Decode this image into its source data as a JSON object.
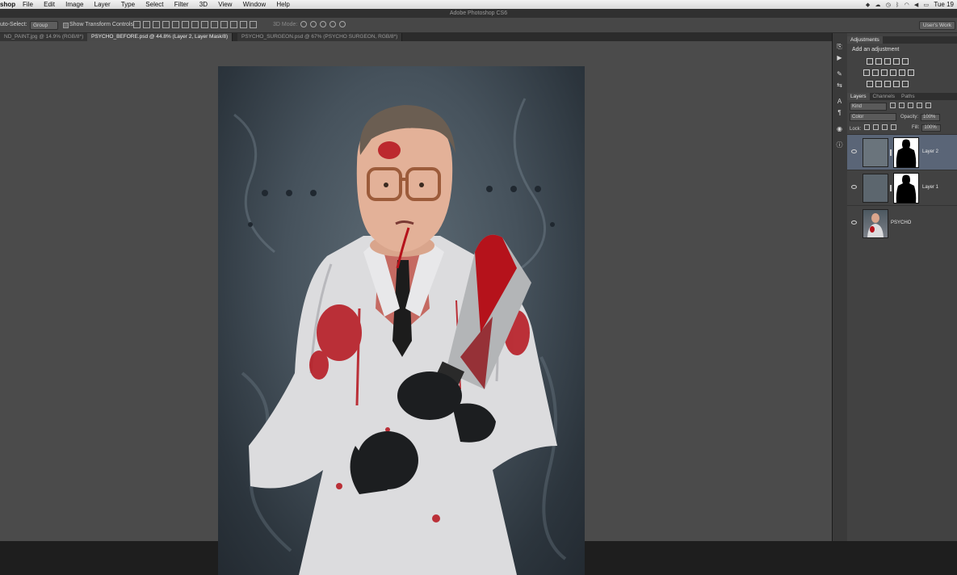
{
  "menubar": {
    "app_name": "shop",
    "menus": [
      "File",
      "Edit",
      "Image",
      "Layer",
      "Type",
      "Select",
      "Filter",
      "3D",
      "View",
      "Window",
      "Help"
    ],
    "clock": "Tue 19"
  },
  "window": {
    "title": "Adobe Photoshop CS6"
  },
  "options_bar": {
    "auto_select_label": "uto-Select:",
    "auto_select_value": "Group",
    "show_transform_label": "Show Transform Controls",
    "mode_label": "3D Mode:",
    "workspace": "User's Work"
  },
  "document_tabs": [
    {
      "label": "ND_PAINT.jpg @ 14.9% (RGB/8*)",
      "active": false
    },
    {
      "label": "PSYCHO_BEFORE.psd @ 44.8% (Layer 2, Layer Mask/8)",
      "active": true
    },
    {
      "label": "PSYCHO_SURGEON.psd @ 67% (PSYCHO SURGEON, RGB/8*)",
      "active": false
    }
  ],
  "panels": {
    "top_tab": "Adjustments",
    "add_adjustment": "Add an adjustment",
    "layer_tabs": [
      "Layers",
      "Channels",
      "Paths"
    ],
    "filter_kind": "Kind",
    "blend_mode": "Color",
    "opacity_label": "Opacity:",
    "opacity_value": "100%",
    "lock_label": "Lock:",
    "fill_label": "Fill:",
    "fill_value": "100%"
  },
  "layers": [
    {
      "name": "Layer 2",
      "selected": true,
      "has_mask": true
    },
    {
      "name": "Layer 1",
      "selected": false,
      "has_mask": true
    },
    {
      "name": "PSYCHO",
      "selected": false,
      "has_mask": false
    }
  ],
  "colors": {
    "canvas_bg": "#4b4b4b",
    "panel_bg": "#424242",
    "selected_layer": "#5a6577",
    "blood_red": "#b5121b"
  }
}
